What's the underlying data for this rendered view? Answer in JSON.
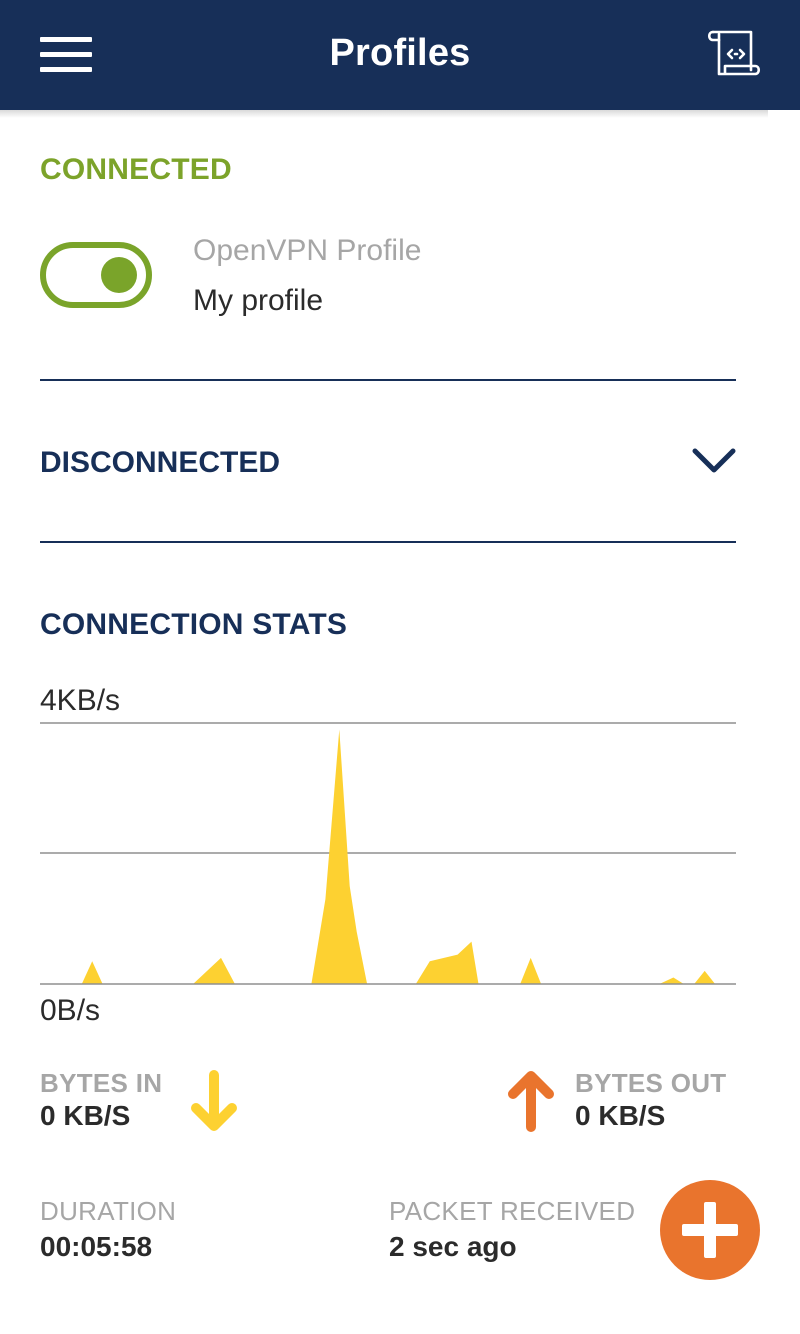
{
  "header": {
    "title": "Profiles",
    "menu_icon": "hamburger-menu-icon",
    "log_icon": "log-scroll-icon"
  },
  "connected_section": {
    "label": "CONNECTED",
    "toggle_on": true,
    "profile_type": "OpenVPN Profile",
    "profile_name": "My profile"
  },
  "disconnected_section": {
    "label": "DISCONNECTED",
    "expand_icon": "chevron-down-icon"
  },
  "stats": {
    "label": "CONNECTION STATS",
    "chart_data": {
      "type": "area",
      "ylim": [
        0,
        4
      ],
      "y_unit": "KB/s",
      "y_tick_labels": [
        "4KB/s",
        "0B/s"
      ],
      "series": [
        {
          "color": "#fdd131",
          "points": [
            [
              0,
              0
            ],
            [
              0.06,
              0
            ],
            [
              0.075,
              0.35
            ],
            [
              0.09,
              0
            ],
            [
              0.22,
              0
            ],
            [
              0.26,
              0.4
            ],
            [
              0.28,
              0
            ],
            [
              0.39,
              0
            ],
            [
              0.41,
              1.3
            ],
            [
              0.43,
              3.9
            ],
            [
              0.445,
              1.5
            ],
            [
              0.455,
              0.8
            ],
            [
              0.47,
              0
            ],
            [
              0.54,
              0
            ],
            [
              0.56,
              0.35
            ],
            [
              0.6,
              0.45
            ],
            [
              0.62,
              0.65
            ],
            [
              0.63,
              0
            ],
            [
              0.69,
              0
            ],
            [
              0.705,
              0.4
            ],
            [
              0.72,
              0
            ],
            [
              0.89,
              0
            ],
            [
              0.91,
              0.1
            ],
            [
              0.925,
              0
            ],
            [
              0.94,
              0
            ],
            [
              0.955,
              0.2
            ],
            [
              0.97,
              0
            ]
          ]
        }
      ],
      "grid": true
    },
    "bytes_in": {
      "caption": "BYTES IN",
      "value": "0 KB/S",
      "icon": "arrow-down-icon",
      "color": "#fdd131"
    },
    "bytes_out": {
      "caption": "BYTES OUT",
      "value": "0 KB/S",
      "icon": "arrow-up-icon",
      "color": "#e9742d"
    },
    "duration": {
      "caption": "DURATION",
      "value": "00:05:58"
    },
    "packet_received": {
      "caption": "PACKET RECEIVED",
      "value": "2 sec ago"
    }
  },
  "fab": {
    "icon": "plus-icon"
  },
  "colors": {
    "header_bg": "#172f58",
    "connected_green": "#7aa42a",
    "accent_orange": "#e9742d",
    "chart_yellow": "#fdd131"
  }
}
